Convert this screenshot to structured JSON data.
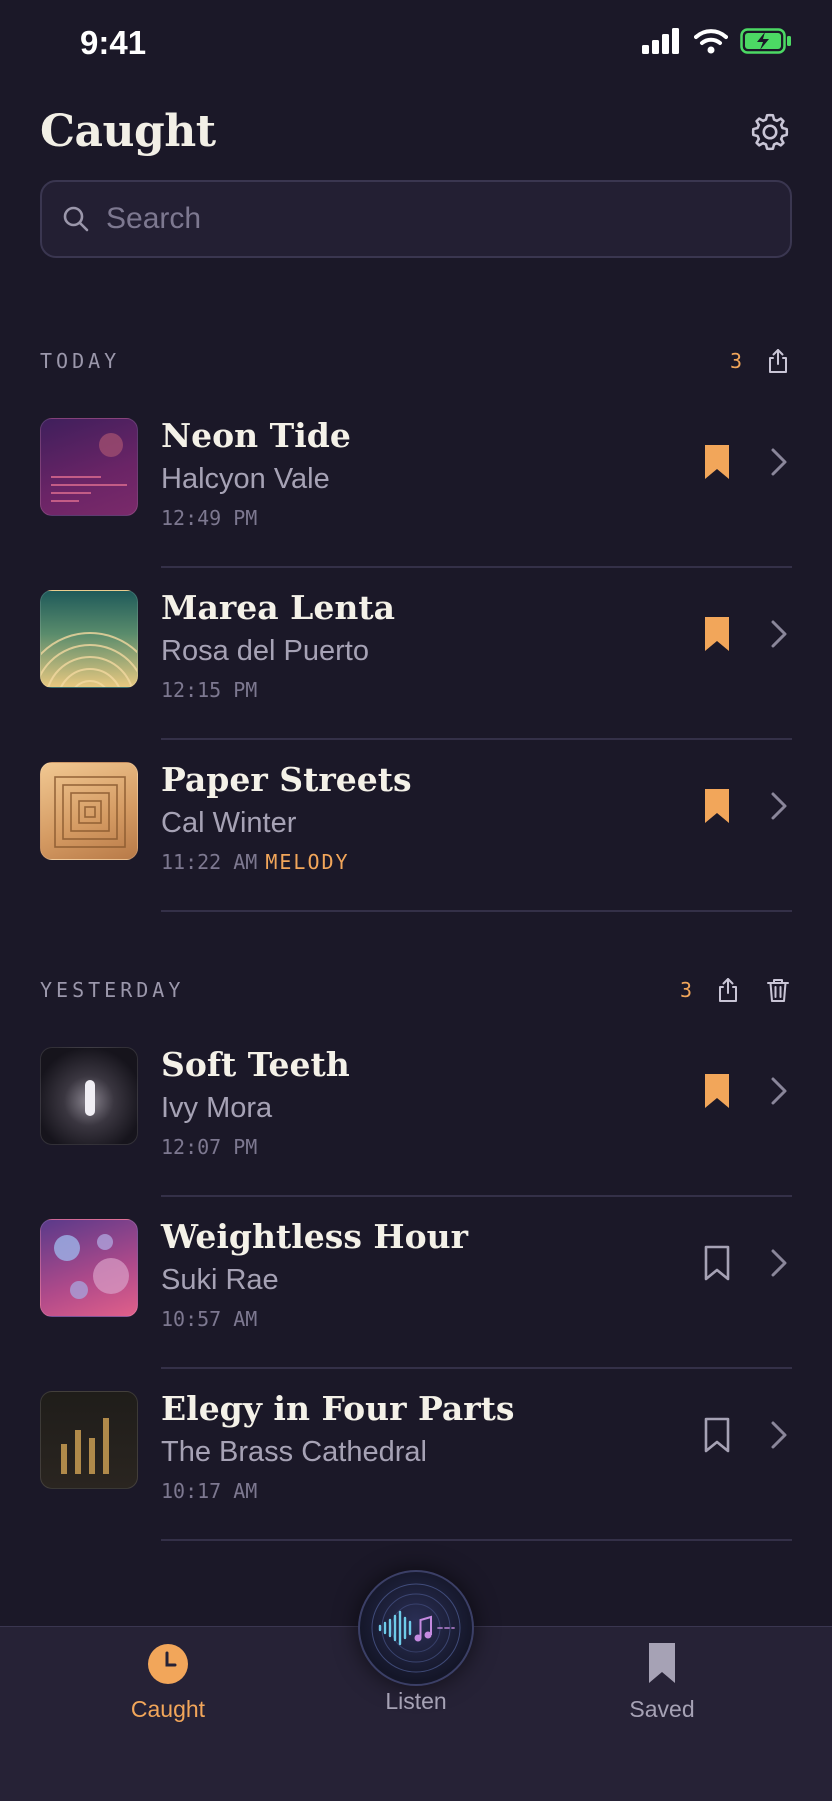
{
  "status": {
    "time": "9:41"
  },
  "header": {
    "title": "Caught"
  },
  "search": {
    "placeholder": "Search"
  },
  "sections": [
    {
      "label": "TODAY",
      "count": "3",
      "items": [
        {
          "title": "Neon Tide",
          "artist": "Halcyon Vale",
          "time": "12:49 PM",
          "tag": "",
          "saved": true
        },
        {
          "title": "Marea Lenta",
          "artist": "Rosa del Puerto",
          "time": "12:15 PM",
          "tag": "",
          "saved": true
        },
        {
          "title": "Paper Streets",
          "artist": "Cal Winter",
          "time": "11:22 AM",
          "tag": "MELODY",
          "saved": true
        }
      ]
    },
    {
      "label": "YESTERDAY",
      "count": "3",
      "items": [
        {
          "title": "Soft Teeth",
          "artist": "Ivy Mora",
          "time": "12:07 PM",
          "tag": "",
          "saved": true
        },
        {
          "title": "Weightless Hour",
          "artist": "Suki Rae",
          "time": "10:57 AM",
          "tag": "",
          "saved": false
        },
        {
          "title": "Elegy in Four Parts",
          "artist": "The Brass Cathedral",
          "time": "10:17 AM",
          "tag": "",
          "saved": false
        }
      ]
    }
  ],
  "tabs": {
    "caught": "Caught",
    "listen": "Listen",
    "saved": "Saved"
  },
  "colors": {
    "accent": "#f2a65a",
    "background": "#1b1828",
    "muted": "#7d7890"
  }
}
